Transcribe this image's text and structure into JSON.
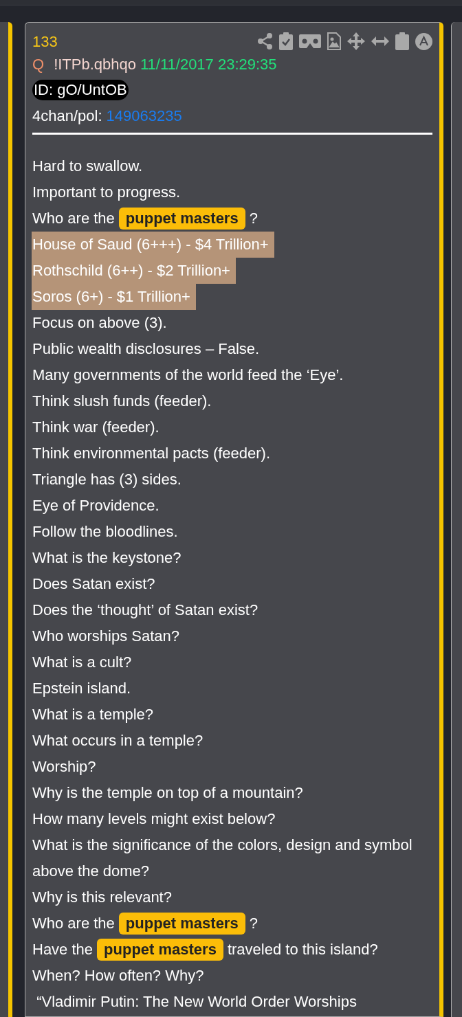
{
  "post": {
    "number": "133",
    "name": "Q",
    "tripcode": "!ITPb.qbhqo",
    "timestamp": "11/11/2017 23:29:35",
    "id": "ID: gO/UntOB",
    "source": "4chan/pol:",
    "post_link": "149063235",
    "lines": [
      {
        "kind": "plain",
        "text": "Hard to swallow."
      },
      {
        "kind": "plain",
        "text": "Important to progress."
      },
      {
        "kind": "tagged",
        "parts": [
          {
            "kind": "text",
            "text": "Who are the"
          },
          {
            "kind": "tag",
            "text": "puppet masters"
          },
          {
            "kind": "text",
            "text": "?"
          }
        ]
      },
      {
        "kind": "highlight",
        "text": "House of Saud (6+++) - $4 Trillion+"
      },
      {
        "kind": "highlight",
        "text": "Rothschild (6++) - $2 Trillion+"
      },
      {
        "kind": "highlight",
        "text": "Soros (6+) - $1 Trillion+"
      },
      {
        "kind": "plain",
        "text": "Focus on above (3)."
      },
      {
        "kind": "plain",
        "text": "Public wealth disclosures – False."
      },
      {
        "kind": "plain",
        "text": "Many governments of the world feed the ‘Eye’."
      },
      {
        "kind": "plain",
        "text": "Think slush funds (feeder)."
      },
      {
        "kind": "plain",
        "text": "Think war (feeder)."
      },
      {
        "kind": "plain",
        "text": "Think environmental pacts (feeder)."
      },
      {
        "kind": "plain",
        "text": "Triangle has (3) sides."
      },
      {
        "kind": "plain",
        "text": "Eye of Providence."
      },
      {
        "kind": "plain",
        "text": "Follow the bloodlines."
      },
      {
        "kind": "plain",
        "text": "What is the keystone?"
      },
      {
        "kind": "plain",
        "text": "Does Satan exist?"
      },
      {
        "kind": "plain",
        "text": "Does the ‘thought’ of Satan exist?"
      },
      {
        "kind": "plain",
        "text": "Who worships Satan?"
      },
      {
        "kind": "plain",
        "text": "What is a cult?"
      },
      {
        "kind": "plain",
        "text": "Epstein island."
      },
      {
        "kind": "plain",
        "text": "What is a temple?"
      },
      {
        "kind": "plain",
        "text": "What occurs in a temple?"
      },
      {
        "kind": "plain",
        "text": "Worship?"
      },
      {
        "kind": "plain",
        "text": "Why is the temple on top of a mountain?"
      },
      {
        "kind": "plain",
        "text": "How many levels might exist below?"
      },
      {
        "kind": "plain",
        "text": "What is the significance of the colors, design and symbol above the dome?"
      },
      {
        "kind": "plain",
        "text": "Why is this relevant?"
      },
      {
        "kind": "tagged",
        "parts": [
          {
            "kind": "text",
            "text": "Who are the"
          },
          {
            "kind": "tag",
            "text": "puppet masters"
          },
          {
            "kind": "text",
            "text": "?"
          }
        ]
      },
      {
        "kind": "tagged",
        "parts": [
          {
            "kind": "text",
            "text": "Have the"
          },
          {
            "kind": "tag",
            "text": "puppet masters"
          },
          {
            "kind": "text",
            "text": "traveled to this island?"
          }
        ]
      },
      {
        "kind": "plain",
        "text": "When? How often? Why?"
      },
      {
        "kind": "plain",
        "text": " “Vladimir Putin: The New World Order Worships"
      }
    ]
  }
}
